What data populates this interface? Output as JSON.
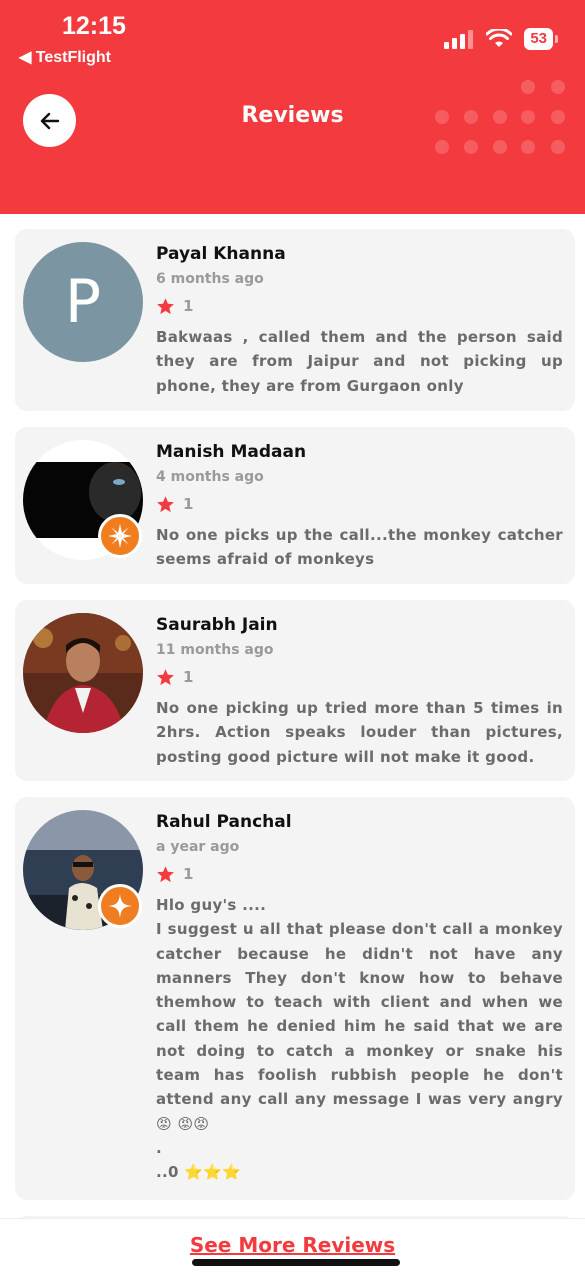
{
  "status_bar": {
    "time": "12:15",
    "back_app": "◀ TestFlight",
    "battery": "53"
  },
  "header": {
    "title": "Reviews"
  },
  "reviews": [
    {
      "name": "Payal Khanna",
      "time_ago": "6 months ago",
      "rating": "1",
      "avatar_letter": "P",
      "text": "Bakwaas , called them and the person said they are from Jaipur and not picking up phone, they are from Gurgaon only"
    },
    {
      "name": "Manish Madaan",
      "time_ago": "4 months ago",
      "rating": "1",
      "text": "No one picks up the call...the monkey catcher seems afraid of monkeys"
    },
    {
      "name": "Saurabh Jain",
      "time_ago": "11 months ago",
      "rating": "1",
      "text": "No one picking up tried more than 5 times in 2hrs. Action speaks louder than pictures, posting good picture will not make it good."
    },
    {
      "name": "Rahul Panchal",
      "time_ago": "a year ago",
      "rating": "1",
      "text": "Hlo guy's ....\nI suggest u all that please don't call a monkey catcher because he didn't not have any manners They don't know how to behave themhow to teach with client and when we call them he denied him he said that we are not doing to catch a monkey or snake his team has foolish rubbish people he don't attend any call any message I was very angry 😡 😡😡\n.\n..0 ⭐⭐⭐"
    }
  ],
  "footer": {
    "see_more": "See More Reviews"
  },
  "colors": {
    "accent": "#f33a3f",
    "badge": "#f07d1f",
    "card_bg": "#f4f4f4"
  }
}
